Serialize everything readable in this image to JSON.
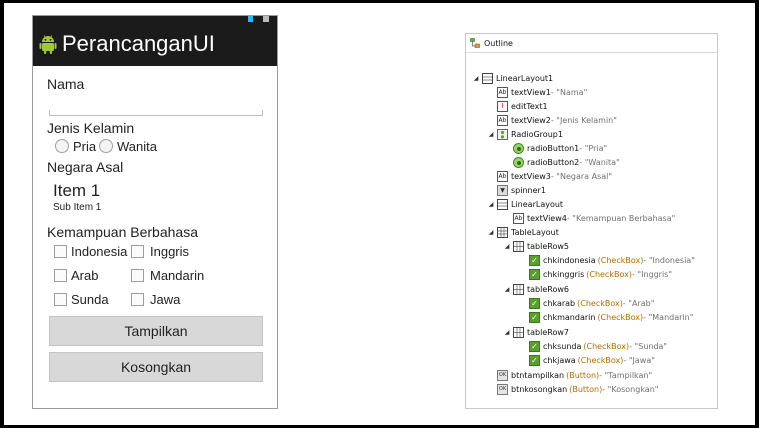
{
  "phone": {
    "app_title": "PerancanganUI",
    "label_name": "Nama",
    "label_gender": "Jenis Kelamin",
    "radio_options": [
      "Pria",
      "Wanita"
    ],
    "label_country": "Negara Asal",
    "spinner_item": "Item 1",
    "spinner_subitem": "Sub Item 1",
    "label_languages": "Kemampuan Berbahasa",
    "languages": [
      "Indonesia",
      "Inggris",
      "Arab",
      "Mandarin",
      "Sunda",
      "Jawa"
    ],
    "btn_show": "Tampilkan",
    "btn_clear": "Kosongkan"
  },
  "outline": {
    "title": "Outline",
    "rows": [
      {
        "name": "LinearLayout1",
        "detail": ""
      },
      {
        "name": "textView1",
        "detail": " - \"Nama\""
      },
      {
        "name": "editText1",
        "detail": ""
      },
      {
        "name": "textView2",
        "detail": " - \"Jenis Kelamin\""
      },
      {
        "name": "RadioGroup1",
        "detail": ""
      },
      {
        "name": "radioButton1",
        "detail": " - \"Pria\""
      },
      {
        "name": "radioButton2",
        "detail": " - \"Wanita\""
      },
      {
        "name": "textView3",
        "detail": " - \"Negara Asal\""
      },
      {
        "name": "spinner1",
        "detail": ""
      },
      {
        "name": "LinearLayout",
        "detail": ""
      },
      {
        "name": "textView4",
        "detail": " - \"Kemampuan Berbahasa\""
      },
      {
        "name": "TableLayout",
        "detail": ""
      },
      {
        "name": "tableRow5",
        "detail": ""
      },
      {
        "name": "chkindonesia",
        "type": "(CheckBox)",
        "detail": " - \"Indonesia\""
      },
      {
        "name": "chkinggris",
        "type": "(CheckBox)",
        "detail": " - \"Inggris\""
      },
      {
        "name": "tableRow6",
        "detail": ""
      },
      {
        "name": "chkarab",
        "type": "(CheckBox)",
        "detail": " - \"Arab\""
      },
      {
        "name": "chkmandarin",
        "type": "(CheckBox)",
        "detail": " - \"Mandarin\""
      },
      {
        "name": "tableRow7",
        "detail": ""
      },
      {
        "name": "chksunda",
        "type": "(CheckBox)",
        "detail": " - \"Sunda\""
      },
      {
        "name": "chkjawa",
        "type": "(CheckBox)",
        "detail": " - \"Jawa\""
      },
      {
        "name": "btntampilkan",
        "type": "(Button)",
        "detail": " - \"Tampilkan\""
      },
      {
        "name": "btnkosongkan",
        "type": "(Button)",
        "detail": " - \"Kosongkan\""
      }
    ]
  }
}
